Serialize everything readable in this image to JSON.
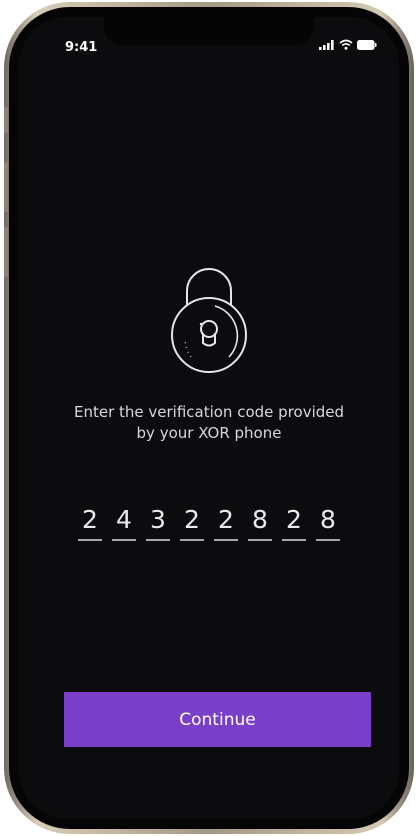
{
  "status_bar": {
    "time": "9:41"
  },
  "lock": {
    "icon": "padlock-icon"
  },
  "prompt": {
    "line1": "Enter the verification code provided",
    "line2": "by your XOR phone"
  },
  "code": {
    "digits": [
      "2",
      "4",
      "3",
      "2",
      "2",
      "8",
      "2",
      "8"
    ]
  },
  "actions": {
    "continue_label": "Continue"
  },
  "colors": {
    "background": "#0c0c0f",
    "accent": "#7a3fc8",
    "text": "#d8d8dc"
  }
}
